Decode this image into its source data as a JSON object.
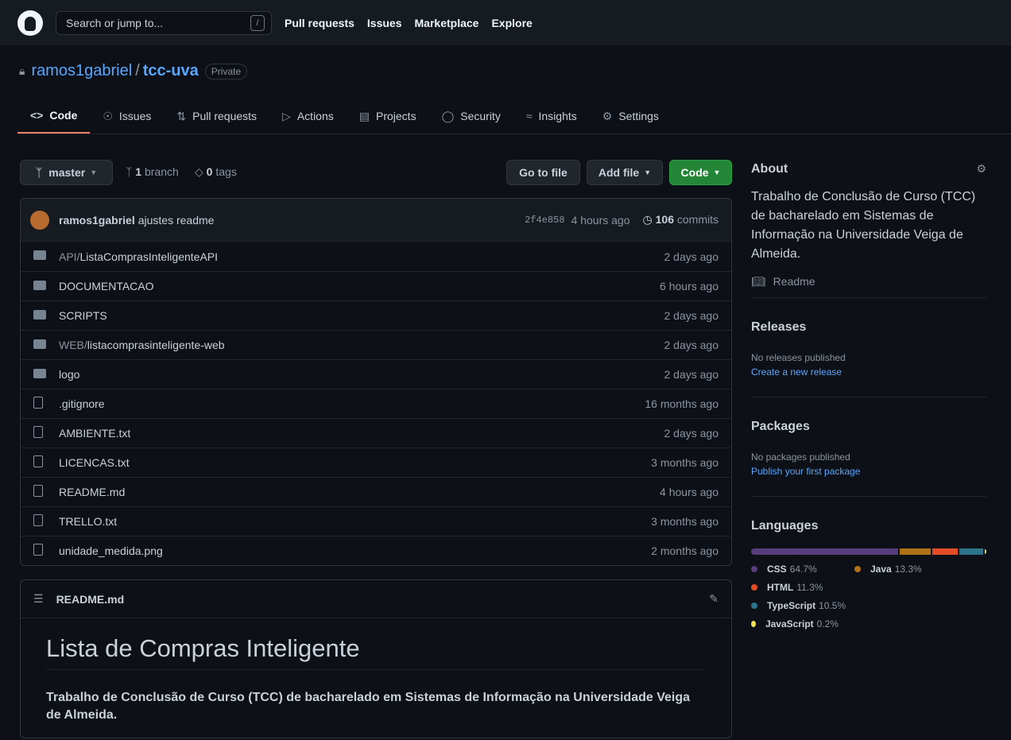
{
  "header": {
    "search_placeholder": "Search or jump to...",
    "slash": "/",
    "nav": [
      "Pull requests",
      "Issues",
      "Marketplace",
      "Explore"
    ]
  },
  "repo": {
    "owner": "ramos1gabriel",
    "sep": "/",
    "name": "tcc-uva",
    "visibility": "Private"
  },
  "tabs": [
    {
      "label": "Code",
      "icon": "code-icon"
    },
    {
      "label": "Issues",
      "icon": "issue-icon"
    },
    {
      "label": "Pull requests",
      "icon": "pull-request-icon"
    },
    {
      "label": "Actions",
      "icon": "play-icon"
    },
    {
      "label": "Projects",
      "icon": "project-icon"
    },
    {
      "label": "Security",
      "icon": "shield-icon"
    },
    {
      "label": "Insights",
      "icon": "graph-icon"
    },
    {
      "label": "Settings",
      "icon": "gear-icon"
    }
  ],
  "toolbar": {
    "branch": "master",
    "branch_count": "1",
    "branch_label": "branch",
    "tag_count": "0",
    "tag_label": "tags",
    "goto": "Go to file",
    "add": "Add file",
    "code": "Code"
  },
  "commit": {
    "author": "ramos1gabriel",
    "message": "ajustes readme",
    "sha": "2f4e858",
    "time": "4 hours ago",
    "count": "106",
    "count_label": "commits"
  },
  "files": [
    {
      "type": "dir",
      "prefix": "API/",
      "name": "ListaComprasInteligenteAPI",
      "age": "2 days ago"
    },
    {
      "type": "dir",
      "prefix": "",
      "name": "DOCUMENTACAO",
      "age": "6 hours ago"
    },
    {
      "type": "dir",
      "prefix": "",
      "name": "SCRIPTS",
      "age": "2 days ago"
    },
    {
      "type": "dir",
      "prefix": "WEB/",
      "name": "listacomprasinteligente-web",
      "age": "2 days ago"
    },
    {
      "type": "dir",
      "prefix": "",
      "name": "logo",
      "age": "2 days ago"
    },
    {
      "type": "file",
      "prefix": "",
      "name": ".gitignore",
      "age": "16 months ago"
    },
    {
      "type": "file",
      "prefix": "",
      "name": "AMBIENTE.txt",
      "age": "2 days ago"
    },
    {
      "type": "file",
      "prefix": "",
      "name": "LICENCAS.txt",
      "age": "3 months ago"
    },
    {
      "type": "file",
      "prefix": "",
      "name": "README.md",
      "age": "4 hours ago"
    },
    {
      "type": "file",
      "prefix": "",
      "name": "TRELLO.txt",
      "age": "3 months ago"
    },
    {
      "type": "file",
      "prefix": "",
      "name": "unidade_medida.png",
      "age": "2 months ago"
    }
  ],
  "readme": {
    "filename": "README.md",
    "title": "Lista de Compras Inteligente",
    "subtitle": "Trabalho de Conclusão de Curso (TCC) de bacharelado em Sistemas de Informação na Universidade Veiga de Almeida."
  },
  "about": {
    "title": "About",
    "description": "Trabalho de Conclusão de Curso (TCC) de bacharelado em Sistemas de Informação na Universidade Veiga de Almeida.",
    "readme": "Readme"
  },
  "releases": {
    "title": "Releases",
    "empty": "No releases published",
    "link": "Create a new release"
  },
  "packages": {
    "title": "Packages",
    "empty": "No packages published",
    "link": "Publish your first package"
  },
  "languages": {
    "title": "Languages",
    "items": [
      {
        "name": "CSS",
        "pct": "64.7%",
        "value": 64.7,
        "color": "#563d7c"
      },
      {
        "name": "Java",
        "pct": "13.3%",
        "value": 13.3,
        "color": "#b07219"
      },
      {
        "name": "HTML",
        "pct": "11.3%",
        "value": 11.3,
        "color": "#e34c26"
      },
      {
        "name": "TypeScript",
        "pct": "10.5%",
        "value": 10.5,
        "color": "#2b7489"
      },
      {
        "name": "JavaScript",
        "pct": "0.2%",
        "value": 0.2,
        "color": "#f1e05a"
      }
    ]
  }
}
